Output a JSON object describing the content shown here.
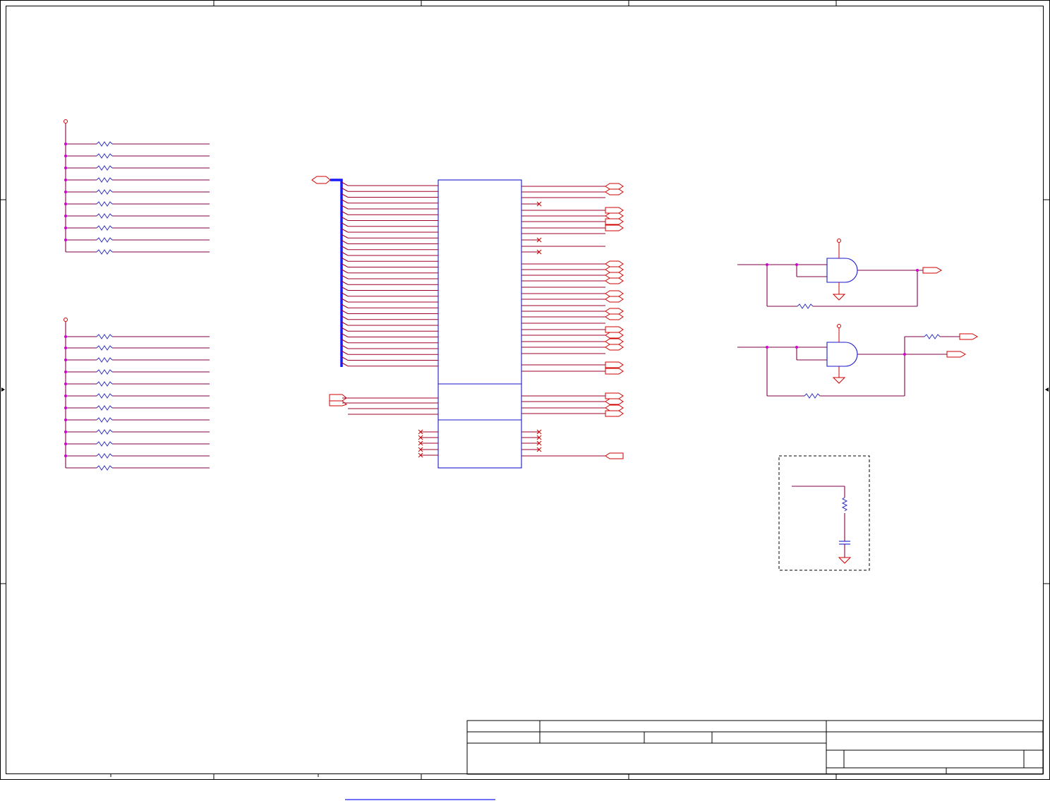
{
  "schematic": {
    "colors": {
      "net_wire": "#a0002a",
      "bus": "#1a1aff",
      "component_outline": "#1a1acc",
      "port": "#d00000",
      "junction": "#d000d0",
      "frame": "#000000",
      "link": "#1a1aff"
    },
    "symbols": [
      "resistor-array",
      "ic-block",
      "and-gate",
      "ground-icon",
      "power-pin-icon",
      "capacitor",
      "no-connect-mark",
      "off-page-port"
    ]
  }
}
